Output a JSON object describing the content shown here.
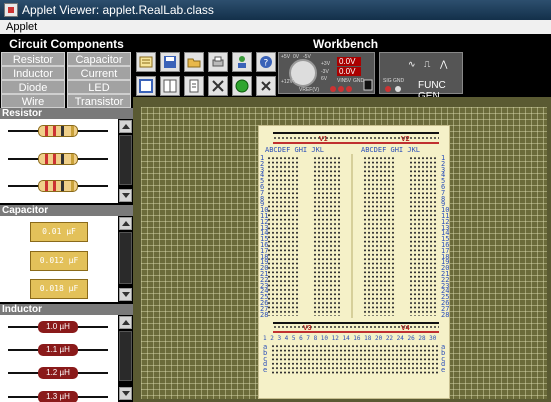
{
  "window": {
    "title": "Applet Viewer: applet.RealLab.class"
  },
  "menu": {
    "items": [
      "Applet"
    ]
  },
  "left_panel": {
    "title": "Circuit Components",
    "components": [
      "Resistor",
      "Capacitor",
      "Inductor",
      "Current",
      "Diode",
      "LED",
      "Wire",
      "Transistor"
    ],
    "resistor": {
      "label": "Resistor"
    },
    "capacitor": {
      "label": "Capacitor",
      "items": [
        "0.01 µF",
        "0.012 µF",
        "0.018 µF"
      ]
    },
    "inductor": {
      "label": "Inductor",
      "items": [
        "1.0 µH",
        "1.1 µH",
        "1.2 µH",
        "1.3 µH"
      ]
    }
  },
  "workbench": {
    "title": "Workbench",
    "meter": {
      "reading1": "0.0V",
      "reading2": "0.0V",
      "labels": [
        "+5V",
        "0V",
        "-5V",
        "+3V",
        "-3V",
        "6V",
        "+12V",
        "-12V",
        "VIN",
        "5V",
        "GND",
        "VREF(V)"
      ]
    },
    "func_gen": {
      "label": "FUNC GEN",
      "sig_gnd": "SIG GND"
    }
  },
  "breadboard": {
    "v1": "V1",
    "v2": "V2",
    "v3": "V3",
    "v4": "V4",
    "cols_left": "ABCDEF  GHI JKL",
    "cols_right": "ABCDEF  GHI JKL",
    "rows": [
      "1",
      "2",
      "3",
      "4",
      "5",
      "6",
      "7",
      "8",
      "9",
      "10",
      "11",
      "12",
      "13",
      "14",
      "15",
      "16",
      "17",
      "18",
      "19",
      "20",
      "21",
      "22",
      "23",
      "24",
      "25",
      "26",
      "27",
      "28"
    ],
    "bottom_numbers": "1 2 3 4 5 6 7 8 10 12 14 16 18 20 22 24 26 28 30",
    "bottom_letters": [
      "a",
      "b",
      "c",
      "d",
      "e"
    ]
  },
  "colors": {
    "board_bg": "#6b6b3a",
    "breadboard": "#f5f1c8",
    "rail_red": "#c03030",
    "rail_black": "#111111",
    "blue_label": "#2a4eb8"
  }
}
